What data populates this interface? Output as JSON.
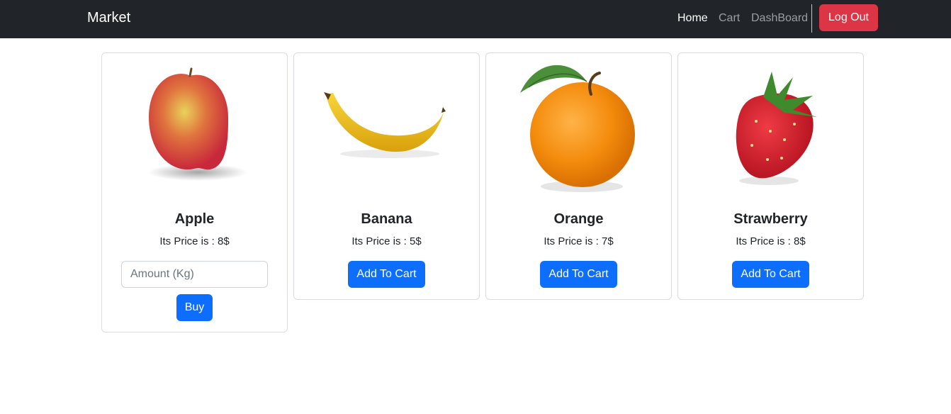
{
  "navbar": {
    "brand": "Market",
    "links": [
      {
        "label": "Home",
        "active": true
      },
      {
        "label": "Cart",
        "active": false
      },
      {
        "label": "DashBoard",
        "active": false
      }
    ],
    "logout_label": "Log Out"
  },
  "products": [
    {
      "name": "Apple",
      "price_text": "Its Price is : 8$",
      "image_icon": "apple-image",
      "amount_placeholder": "Amount (Kg)",
      "buy_label": "Buy"
    },
    {
      "name": "Banana",
      "price_text": "Its Price is : 5$",
      "image_icon": "banana-image",
      "button_label": "Add To Cart"
    },
    {
      "name": "Orange",
      "price_text": "Its Price is : 7$",
      "image_icon": "orange-image",
      "button_label": "Add To Cart"
    },
    {
      "name": "Strawberry",
      "price_text": "Its Price is : 8$",
      "image_icon": "strawberry-image",
      "button_label": "Add To Cart"
    }
  ],
  "colors": {
    "navbar_bg": "#212529",
    "primary": "#0d6efd",
    "danger": "#dc3545"
  }
}
